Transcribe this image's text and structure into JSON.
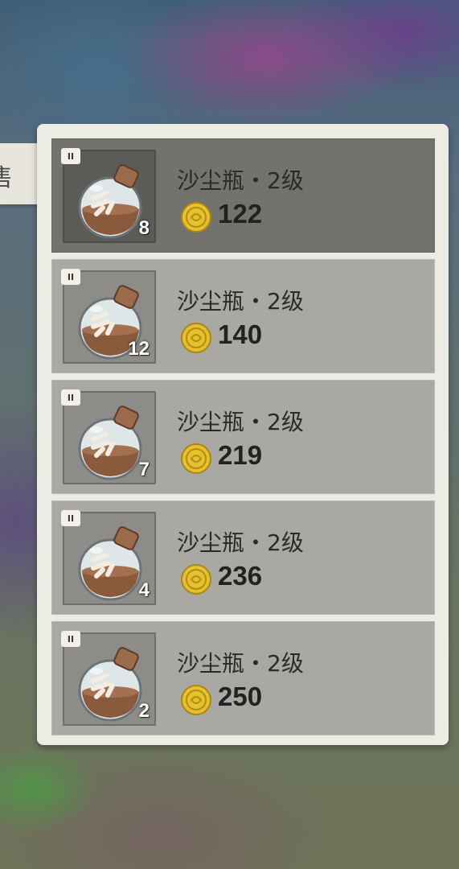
{
  "side_tab": {
    "label": "售"
  },
  "items": [
    {
      "tier": "II",
      "name": "沙尘瓶・2级",
      "count": "8",
      "price": "122",
      "selected": true,
      "icon": "sand-bottle-icon"
    },
    {
      "tier": "II",
      "name": "沙尘瓶・2级",
      "count": "12",
      "price": "140",
      "selected": false,
      "icon": "sand-bottle-icon"
    },
    {
      "tier": "II",
      "name": "沙尘瓶・2级",
      "count": "7",
      "price": "219",
      "selected": false,
      "icon": "sand-bottle-icon"
    },
    {
      "tier": "II",
      "name": "沙尘瓶・2级",
      "count": "4",
      "price": "236",
      "selected": false,
      "icon": "sand-bottle-icon"
    },
    {
      "tier": "II",
      "name": "沙尘瓶・2级",
      "count": "2",
      "price": "250",
      "selected": false,
      "icon": "sand-bottle-icon"
    }
  ],
  "colors": {
    "row_selected": "#73726d",
    "row_default": "#a9a8a3",
    "panel": "#ecebe4",
    "coin": "#e6c12b"
  }
}
